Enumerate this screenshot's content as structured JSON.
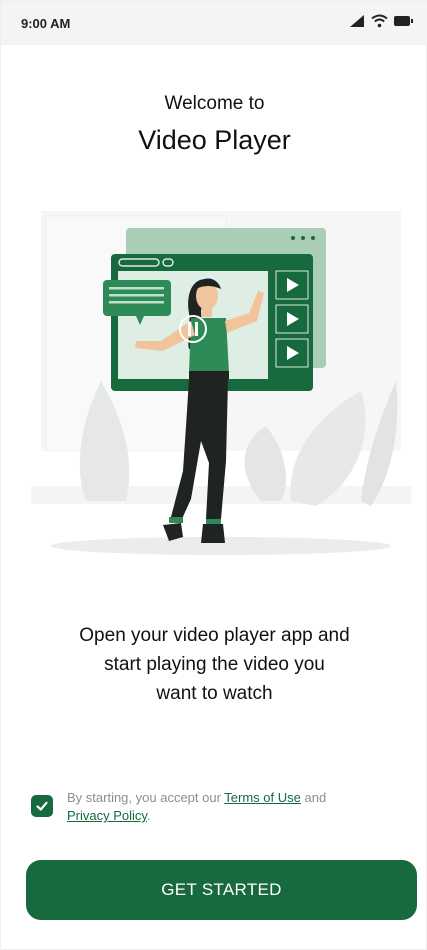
{
  "status_bar": {
    "time": "9:00 AM"
  },
  "header": {
    "welcome": "Welcome to",
    "title": "Video Player"
  },
  "description": {
    "line1": "Open your video player app and",
    "line2": "start playing the video you",
    "line3": "want to watch"
  },
  "consent": {
    "checked": true,
    "prefix": "By starting, you accept our ",
    "terms_label": "Terms of Use",
    "middle": " and",
    "privacy_label": "Privacy Policy",
    "suffix": "."
  },
  "cta": {
    "label": "GET STARTED"
  },
  "colors": {
    "brand": "#17693e",
    "brand_light": "#a9cdb5",
    "muted_text": "#8b8f8d"
  },
  "icons": [
    "signal-icon",
    "wifi-icon",
    "battery-icon",
    "check-icon",
    "play-icon",
    "pause-icon"
  ]
}
